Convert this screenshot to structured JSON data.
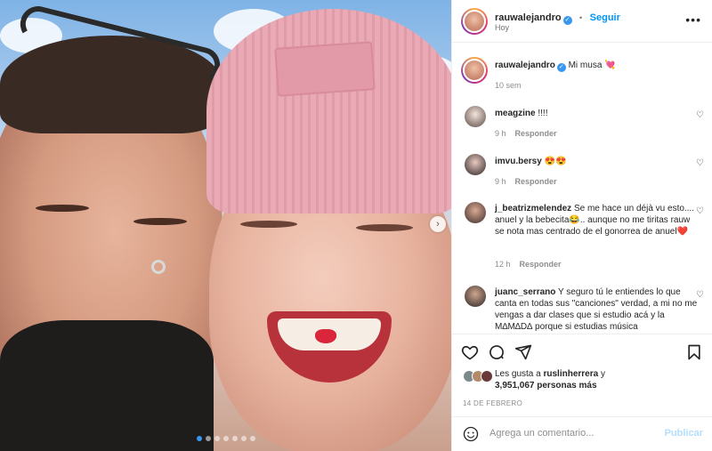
{
  "post": {
    "author": "rauwalejandro",
    "follow_label": "Seguir",
    "location_subtitle": "Hoy",
    "caption": "Mi musa 💘",
    "caption_age": "10 sem",
    "carousel": {
      "slide_count": 7,
      "active_index": 0
    }
  },
  "comments": [
    {
      "user": "meagzine",
      "text": "!!!!",
      "age": "9 h",
      "reply_label": "Responder"
    },
    {
      "user": "imvu.bersy",
      "text": "😍😍",
      "age": "9 h",
      "reply_label": "Responder"
    },
    {
      "user": "j_beatrizmelendez",
      "text": "Se me hace un déjà vu esto.... anuel y la bebecita😂.. aunque no me tiritas rauw se nota mas centrado de el gonorrea de anuel❤️",
      "age": "12 h",
      "reply_label": "Responder"
    },
    {
      "user": "juanc_serrano",
      "text": "Y seguro tú le entiendes lo que canta en todas sus \"canciones\" verdad, a mi no me vengas a dar clases que si estudio acá y la M∆M∆D∆ porque si estudias música"
    }
  ],
  "likes": {
    "prefix": "Les gusta a",
    "first_user": "ruslinherrera",
    "connector": "y",
    "count_text": "3,951,067 personas más"
  },
  "date_label": "14 DE FEBRERO",
  "add_comment": {
    "placeholder": "Agrega un comentario...",
    "publish_label": "Publicar"
  },
  "icons": [
    "heart-icon",
    "comment-icon",
    "share-icon",
    "bookmark-icon",
    "emoji-icon",
    "more-icon",
    "verified-icon",
    "next-arrow-icon"
  ],
  "colors": {
    "accent": "#0095f6",
    "verified": "#3897f0",
    "publish_disabled": "#b2dffc"
  }
}
